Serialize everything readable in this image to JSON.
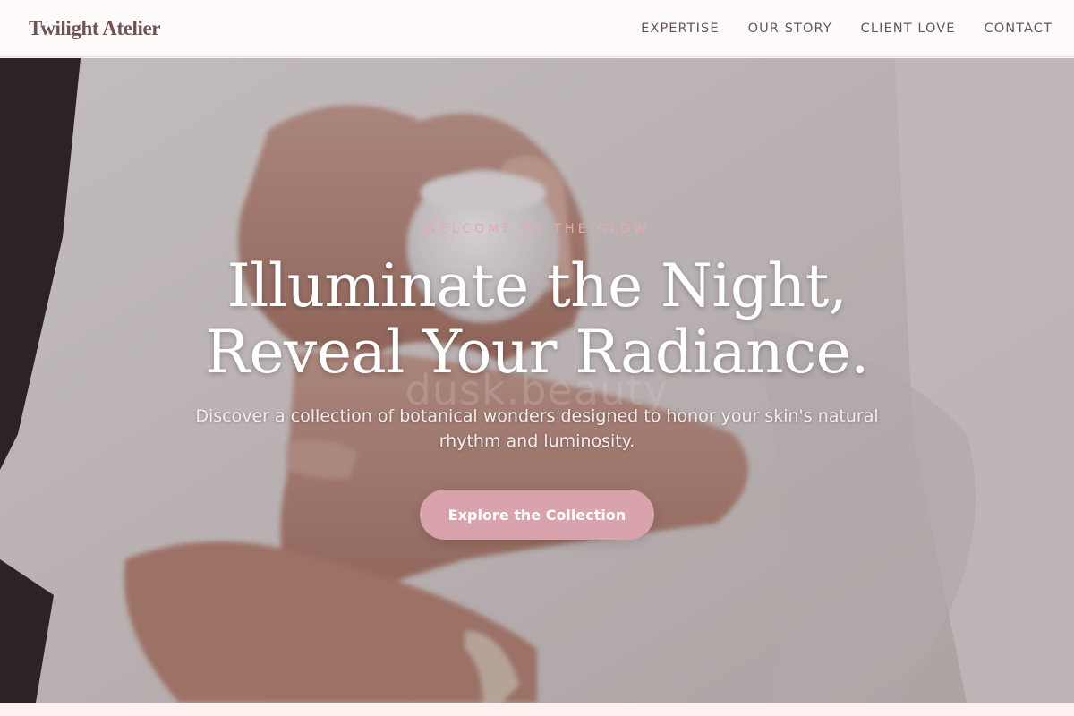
{
  "header": {
    "brand": "Twilight Atelier",
    "nav": [
      {
        "label": "EXPERTISE"
      },
      {
        "label": "OUR STORY"
      },
      {
        "label": "CLIENT LOVE"
      },
      {
        "label": "CONTACT"
      }
    ]
  },
  "hero": {
    "eyebrow": "WELCOME TO THE GLOW",
    "headline_line1": "Illuminate the Night,",
    "headline_line2": "Reveal Your Radiance.",
    "subtext": "Discover a collection of botanical wonders designed to honor your skin's natural rhythm and luminosity.",
    "cta_label": "Explore the Collection",
    "watermark": "dusk.beauty"
  },
  "colors": {
    "accent": "#d8a3ad",
    "brand_text": "#6e5256",
    "eyebrow": "#e3aab4"
  }
}
